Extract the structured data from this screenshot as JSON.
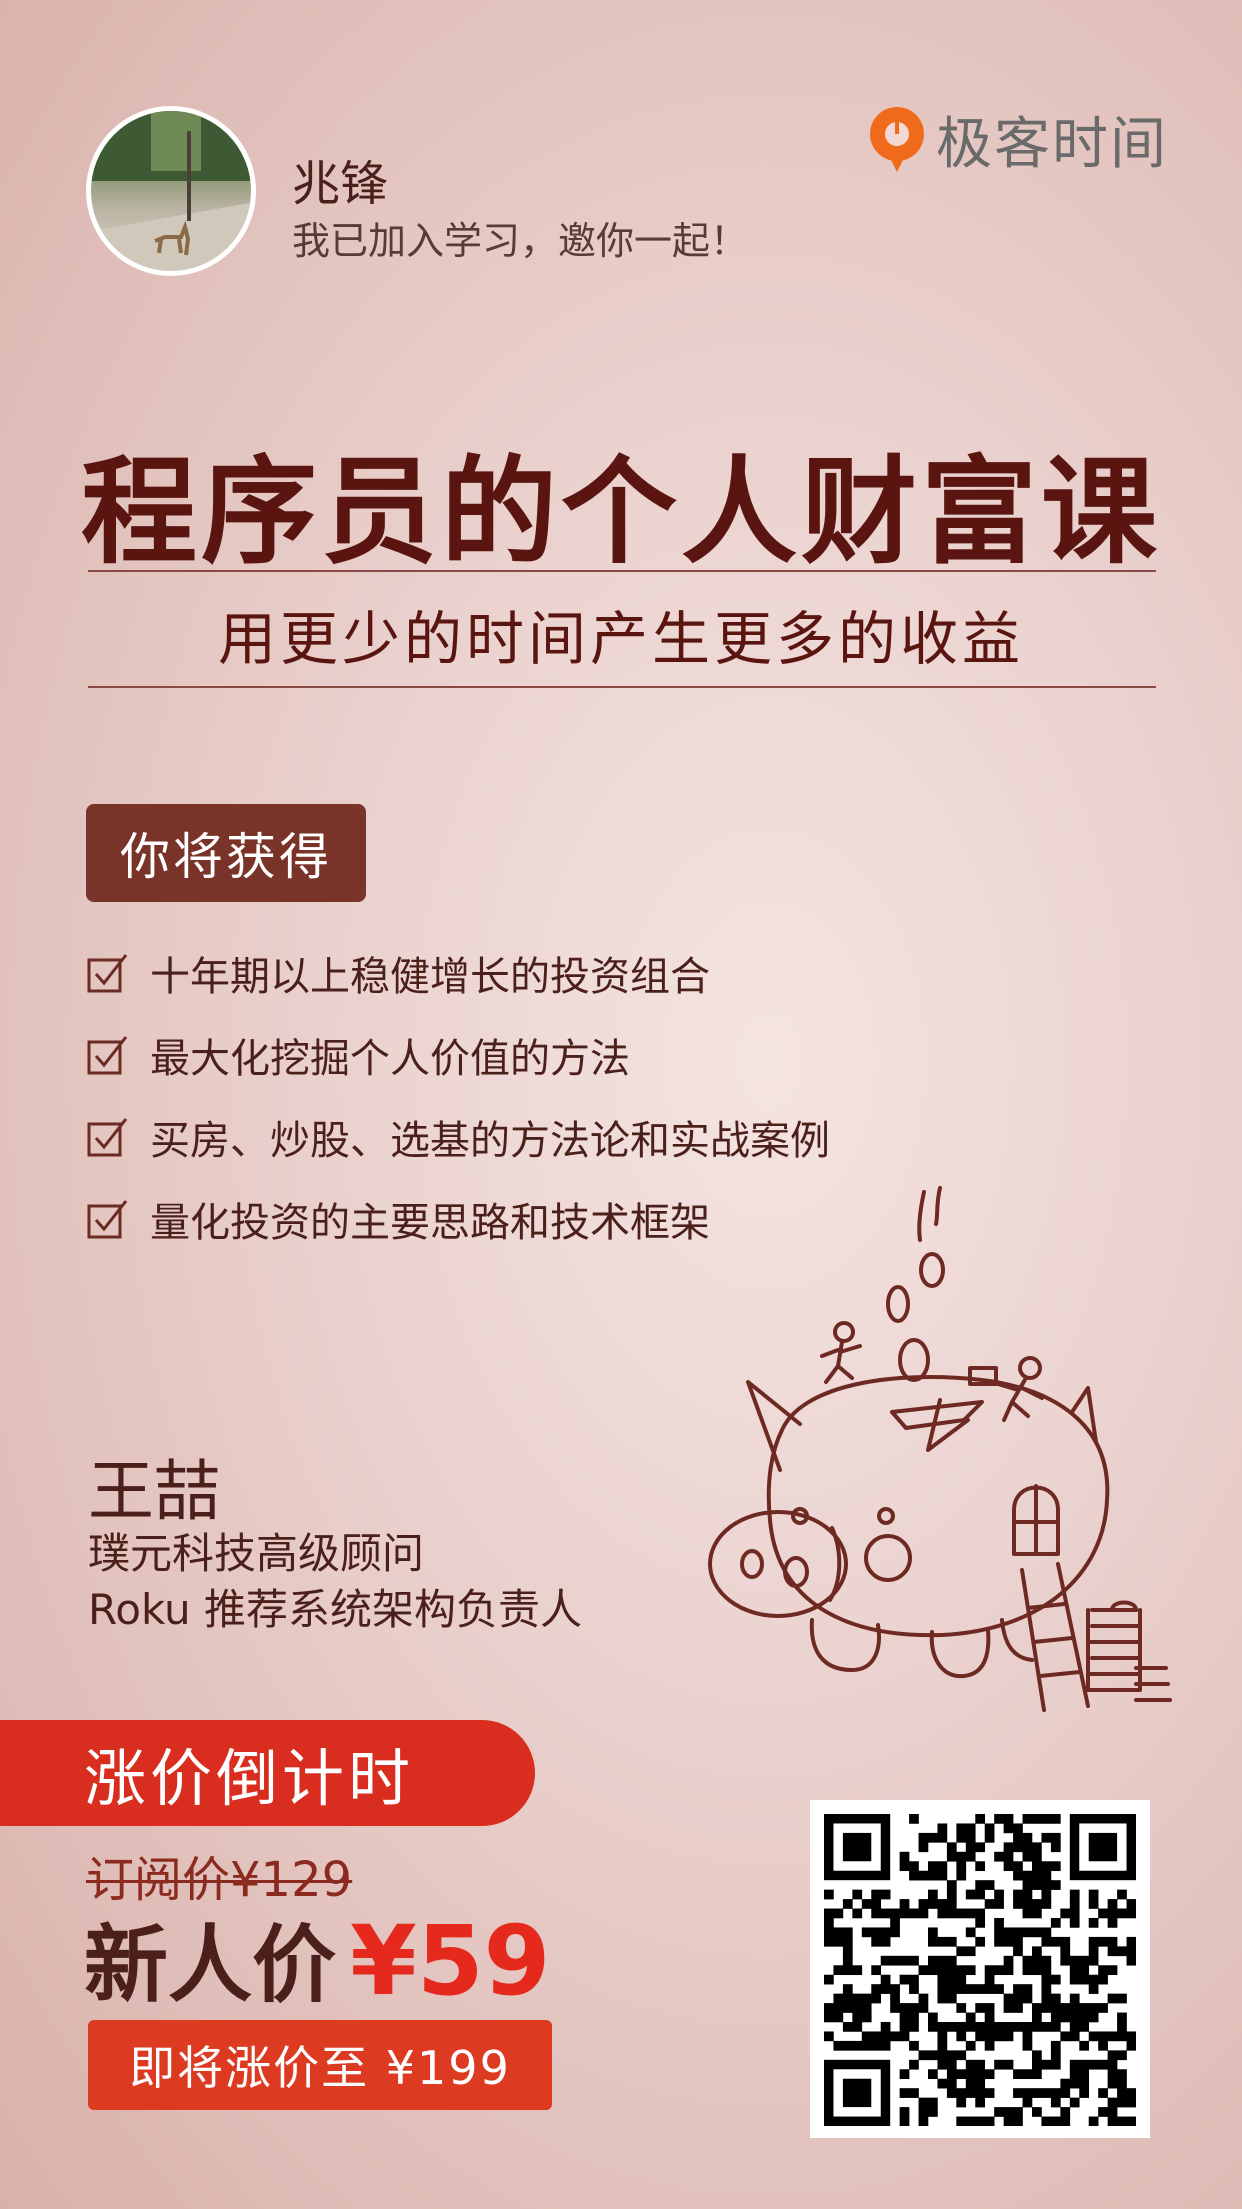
{
  "header": {
    "user_name": "兆锋",
    "user_message": "我已加入学习，邀你一起！",
    "brand": "极客时间"
  },
  "course": {
    "title": "程序员的个人财富课",
    "subtitle": "用更少的时间产生更多的收益"
  },
  "benefits": {
    "heading": "你将获得",
    "items": [
      "十年期以上稳健增长的投资组合",
      "最大化挖掘个人价值的方法",
      "买房、炒股、选基的方法论和实战案例",
      "量化投资的主要思路和技术框架"
    ]
  },
  "author": {
    "name": "王喆",
    "title_1": "璞元科技高级顾问",
    "title_2": "Roku 推荐系统架构负责人"
  },
  "pricing": {
    "countdown_label": "涨价倒计时",
    "original_price": "订阅价¥129",
    "new_price_label": "新人价",
    "new_price_value": "¥59",
    "raise_notice": "即将涨价至 ¥199"
  },
  "colors": {
    "accent_red": "#d82d1f",
    "dark_brown": "#5b1510",
    "badge_brown": "#7a3328",
    "logo_orange": "#f06a1c"
  },
  "icons": [
    "checkbox-checked-icon",
    "brand-logo-icon",
    "piggy-bank-illustration",
    "qr-code"
  ]
}
